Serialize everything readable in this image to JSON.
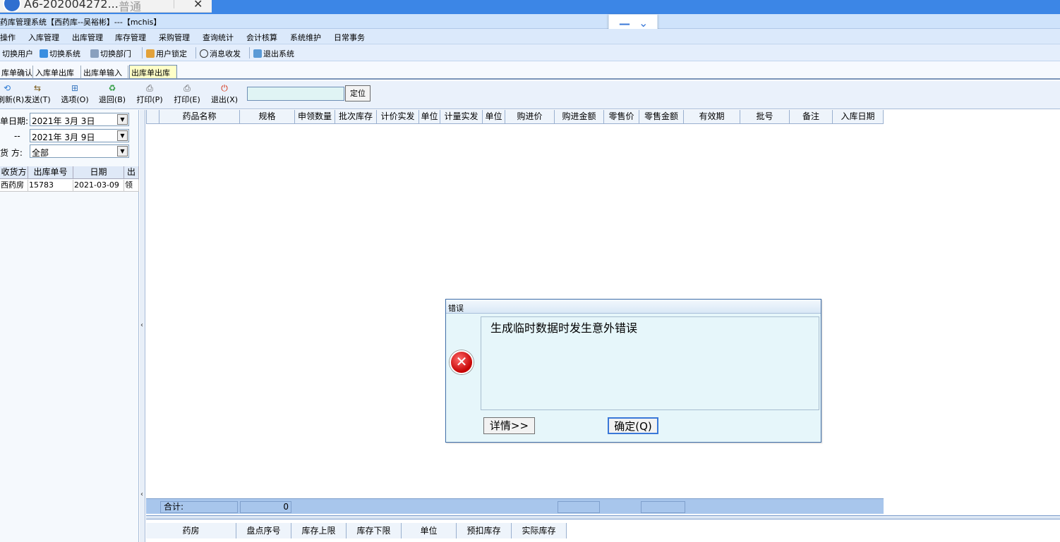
{
  "remote": {
    "tab_title": "A6-202004272...",
    "tab_sub": "普通"
  },
  "window": {
    "title": "药库管理系统【西药库--吴裕彬】---【mchis】"
  },
  "menu": [
    "操作",
    "入库管理",
    "出库管理",
    "库存管理",
    "采购管理",
    "查询统计",
    "会计核算",
    "系统维护",
    "日常事务"
  ],
  "quickbar": [
    "切换用户",
    "切换系统",
    "切换部门",
    "用户锁定",
    "消息收发",
    "退出系统"
  ],
  "module_tabs": [
    "库单确认",
    "入库单出库",
    "出库单输入",
    "出库单出库"
  ],
  "toolbar": {
    "buttons": [
      "刷新(R)",
      "发送(T)",
      "选项(O)",
      "退回(B)",
      "打印(P)",
      "打印(E)",
      "退出(X)"
    ],
    "locate_value": "",
    "locate_label": "定位"
  },
  "filters": {
    "date_label": "单日期:",
    "date_from": "2021年  3月  3日",
    "range_sep": "--",
    "date_to": "2021年  3月  9日",
    "party_label": "货  方:",
    "party_value": "全部"
  },
  "left_table": {
    "headers": [
      "收货方",
      "出库单号",
      "日期",
      "出"
    ],
    "rows": [
      [
        "西药房",
        "15783",
        "2021-03-09",
        "领"
      ]
    ]
  },
  "grid": {
    "headers": [
      "药品名称",
      "规格",
      "申领数量",
      "批次库存",
      "计价实发",
      "单位",
      "计量实发",
      "单位",
      "购进价",
      "购进金额",
      "零售价",
      "零售金额",
      "有效期",
      "批号",
      "备注",
      "入库日期"
    ],
    "total_label": "合计:",
    "total_value": "0"
  },
  "bottom_grid": {
    "headers": [
      "药房",
      "盘点序号",
      "库存上限",
      "库存下限",
      "单位",
      "预扣库存",
      "实际库存"
    ]
  },
  "dialog": {
    "title": "错误",
    "message": "生成临时数据时发生意外错误",
    "details_label": "详情>>",
    "ok_label": "确定(Q)"
  },
  "colors": {
    "accent": "#3c86e6",
    "error": "#d40000",
    "active_tab": "#ffffc8"
  }
}
